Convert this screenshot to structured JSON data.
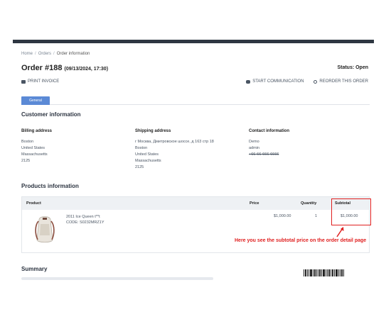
{
  "breadcrumb": {
    "items": [
      "Home",
      "Orders",
      "Order information"
    ],
    "separator": "/"
  },
  "order": {
    "title": "Order #188",
    "date": "(09/13/2024, 17:30)",
    "status": "Status: Open"
  },
  "toolbar": {
    "print_label": "PRINT INVOICE",
    "communication_label": "START COMMUNICATION",
    "reorder_label": "REORDER THIS ORDER"
  },
  "tabs": [
    {
      "label": "General",
      "active": true
    }
  ],
  "customer": {
    "section_title": "Customer information",
    "billing": {
      "title": "Billing address",
      "lines": [
        "Boston",
        "United States",
        "Massachusetts",
        "2125"
      ]
    },
    "shipping": {
      "title": "Shipping address",
      "lines": [
        "г Москва, Дмитровское шоссе, д 163 стр 18",
        "Boston",
        "United States",
        "Massachusetts",
        "2125"
      ]
    },
    "contact": {
      "title": "Contact information",
      "lines": [
        "Demo",
        "admin",
        "+66-66-666-6666"
      ]
    }
  },
  "products": {
    "section_title": "Products information",
    "headers": {
      "product": "Product",
      "price": "Price",
      "quantity": "Quantity",
      "subtotal": "Subtotal"
    },
    "rows": [
      {
        "name": "2011 Ice Queen t**t",
        "code": "CODE: S0232MRZ1Y",
        "price": "$1,000.00",
        "quantity": "1",
        "subtotal": "$1,000.00"
      }
    ]
  },
  "annotation": {
    "text": "Here you see the subtotal price on the order detail page",
    "color": "#e02020"
  },
  "summary": {
    "title": "Summary"
  },
  "colors": {
    "accent": "#5b8ad6",
    "topbar": "#2e3742",
    "highlight": "#e02020"
  }
}
